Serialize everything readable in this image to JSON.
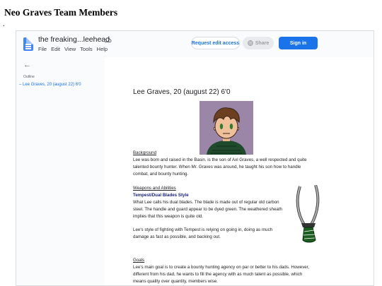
{
  "page_heading": "Neo Graves Team Members",
  "bullet": ".",
  "app": {
    "doc_title": "the freaking...leehead",
    "menu": [
      "File",
      "Edit",
      "View",
      "Tools",
      "Help"
    ],
    "request_edit_label": "Request edit access",
    "share_label": "Share",
    "sign_in_label": "Sign in",
    "colors": {
      "accent": "#1a73e8",
      "doc_icon": "#4285f4"
    }
  },
  "sidebar": {
    "outline_label": "Outline",
    "items": [
      {
        "label": "Lee Graves, 20 (august 22) 6'0"
      }
    ]
  },
  "document": {
    "heading": "Lee Graves, 20 (august 22) 6'0",
    "background_heading": "Background",
    "background_lines": [
      "Lee was born and raised in the Basin. is the son of Axl Graves, a well respected and quite",
      "talented bounty hunter. When Mr. Graves was around, he taught his son how to handle",
      "combat, and bounty hunting."
    ],
    "weapons_heading": "Weapons and Abilities",
    "weapon_name": "Tempest/Dual Blades Style",
    "weapon_lines": [
      "What Lee calls his dual blades. The blade is made out of regular old carbon",
      "steel. The handle and guard appear to be dyed green. The weathered sheath",
      "implies that this weapon is quite old."
    ],
    "style_lines": [
      "Lee's style of fighting with Tempest is relying on going in, doing as much",
      "damage as fast as possible, and backing out."
    ],
    "goals_heading": "Goals",
    "goals_lines": [
      "Lee's main goal is to create a bounty hunting agency on par or better to his dads. However,",
      "different from his dad, he wants to fill the agency with as much talent as possible, which",
      "means quality over quantity, members wise."
    ]
  }
}
